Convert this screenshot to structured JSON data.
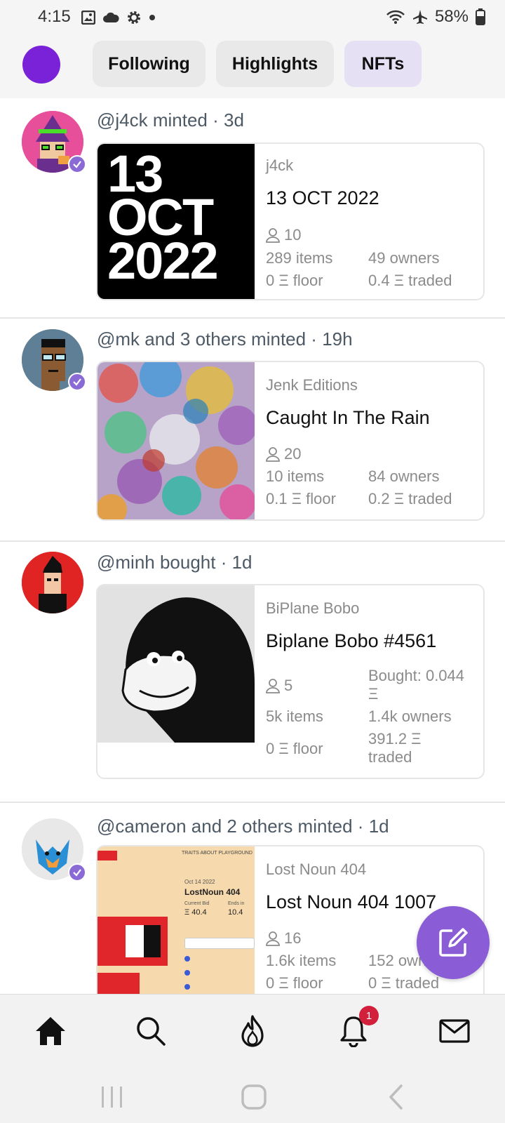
{
  "status_bar": {
    "time": "4:15",
    "battery": "58%",
    "icons": [
      "image-icon",
      "cloud-icon",
      "gear-icon",
      "dot-icon",
      "wifi-icon",
      "airplane-icon",
      "battery-icon"
    ]
  },
  "header": {
    "tabs": [
      {
        "label": "Following",
        "active": false
      },
      {
        "label": "Highlights",
        "active": false
      },
      {
        "label": "NFTs",
        "active": true
      }
    ],
    "avatar_color": "#7a22d8"
  },
  "posts": [
    {
      "header": "@j4ck minted · 3d",
      "verified": true,
      "card": {
        "image_text": [
          "13",
          "OCT",
          "2022"
        ],
        "collection": "j4ck",
        "title": "13 OCT 2022",
        "holders": "10",
        "items": "289 items",
        "owners": "49 owners",
        "floor": "0 Ξ floor",
        "traded": "0.4 Ξ traded"
      }
    },
    {
      "header": "@mk and 3 others minted · 19h",
      "verified": true,
      "card": {
        "collection": "Jenk Editions",
        "title": "Caught In The Rain",
        "holders": "20",
        "items": "10 items",
        "owners": "84 owners",
        "floor": "0.1 Ξ floor",
        "traded": "0.2 Ξ traded"
      }
    },
    {
      "header": "@minh bought · 1d",
      "verified": false,
      "card": {
        "collection": "BiPlane Bobo",
        "title": "Biplane Bobo #4561",
        "holders": "5",
        "bought_line1": "Bought: 0.044",
        "bought_line2": "Ξ",
        "items": "5k items",
        "owners": "1.4k owners",
        "floor": "0 Ξ floor",
        "traded_line1": "391.2 Ξ",
        "traded_line2": "traded"
      }
    },
    {
      "header": "@cameron and 2 others minted · 1d",
      "verified": true,
      "card": {
        "collection": "Lost Noun 404",
        "title": "Lost Noun 404 1007",
        "holders": "16",
        "items": "1.6k items",
        "owners": "152 owners",
        "floor": "0 Ξ floor",
        "traded": "0 Ξ traded",
        "image_text": {
          "nav": "TRAITS  ABOUT  PLAYGROUND",
          "date": "Oct 14 2022",
          "name": "LostNoun 404",
          "bid_label": "Current Bid",
          "bid_value": "Ξ 40.4",
          "bid2_label": "Ends in",
          "bid2_value": "10.4"
        }
      }
    }
  ],
  "fab": {
    "icon": "compose-icon",
    "color": "#8a5cd6"
  },
  "bottom_nav": {
    "items": [
      "home-icon",
      "search-icon",
      "flame-icon",
      "bell-icon",
      "mail-icon"
    ],
    "notification_badge": "1"
  },
  "system_nav": [
    "recents-icon",
    "home-circle-icon",
    "back-icon"
  ]
}
